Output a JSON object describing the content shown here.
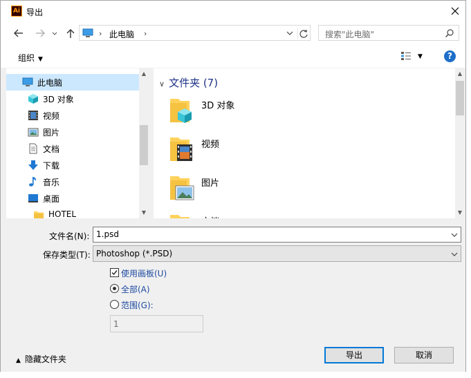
{
  "window": {
    "title": "导出",
    "app_icon_text": "Ai",
    "close_icon": "close-icon"
  },
  "nav": {
    "back_icon": "arrow-left-icon",
    "forward_icon": "arrow-right-icon",
    "up_icon": "arrow-up-icon",
    "breadcrumb": "此电脑",
    "search_placeholder": "搜索\"此电脑\""
  },
  "toolbar": {
    "organize_label": "组织"
  },
  "nav_pane": {
    "items": [
      {
        "label": "此电脑",
        "icon": "computer-icon",
        "selected": true
      },
      {
        "label": "3D 对象",
        "icon": "3d-objects-icon"
      },
      {
        "label": "视频",
        "icon": "video-icon"
      },
      {
        "label": "图片",
        "icon": "pictures-icon"
      },
      {
        "label": "文档",
        "icon": "documents-icon"
      },
      {
        "label": "下载",
        "icon": "download-icon"
      },
      {
        "label": "音乐",
        "icon": "music-icon"
      },
      {
        "label": "桌面",
        "icon": "desktop-icon"
      },
      {
        "label": "HOTEL",
        "icon": "folder-icon"
      }
    ]
  },
  "file_pane": {
    "group_header": "文件夹 (7)",
    "items": [
      {
        "name": "3D 对象",
        "icon": "folder-3d-objects-icon"
      },
      {
        "name": "视频",
        "icon": "folder-video-icon"
      },
      {
        "name": "图片",
        "icon": "folder-pictures-icon"
      },
      {
        "name": "文档",
        "icon": "folder-documents-icon"
      }
    ]
  },
  "form": {
    "filename_label": "文件名(N):",
    "filename_value": "1.psd",
    "filetype_label": "保存类型(T):",
    "filetype_value": "Photoshop (*.PSD)",
    "use_artboards_label": "使用画板(U)",
    "use_artboards_checked": true,
    "all_label": "全部(A)",
    "all_selected": true,
    "range_label": "范围(G):",
    "range_value": "1"
  },
  "footer": {
    "hide_folders_label": "隐藏文件夹",
    "export_label": "导出",
    "cancel_label": "取消"
  }
}
